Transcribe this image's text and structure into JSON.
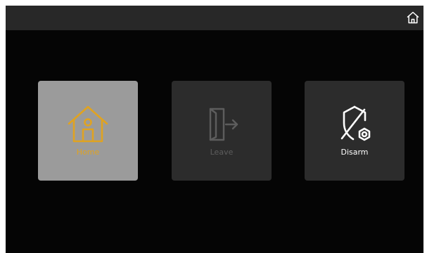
{
  "header": {
    "home_icon": "home-icon"
  },
  "modes": [
    {
      "label": "Home",
      "icon": "house-person-icon",
      "state": "active",
      "color": "#e0a321"
    },
    {
      "label": "Leave",
      "icon": "leave-door-icon",
      "state": "disabled",
      "color": "#5d5d5d"
    },
    {
      "label": "Disarm",
      "icon": "disarm-shield-icon",
      "state": "normal",
      "color": "#ffffff"
    }
  ],
  "colors": {
    "background": "#050505",
    "topbar": "#282828",
    "active_tile": "#9b9b9b",
    "tile": "#2c2c2c",
    "accent": "#e0a321"
  }
}
